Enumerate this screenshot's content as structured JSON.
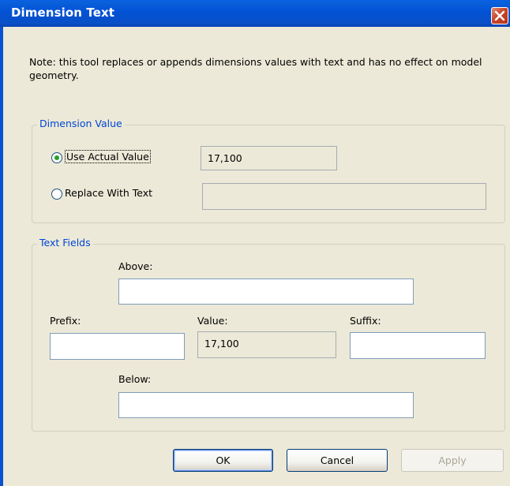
{
  "window": {
    "title": "Dimension Text"
  },
  "note": "Note: this tool replaces or appends dimensions values with text and has no effect on model geometry.",
  "dimension_value": {
    "legend": "Dimension Value",
    "use_actual_label": "Use Actual Value",
    "use_actual_value": "17,100",
    "replace_label": "Replace With Text",
    "replace_value": "",
    "selected": "use_actual"
  },
  "text_fields": {
    "legend": "Text Fields",
    "above_label": "Above:",
    "above_value": "",
    "prefix_label": "Prefix:",
    "prefix_value": "",
    "value_label": "Value:",
    "value_value": "17,100",
    "suffix_label": "Suffix:",
    "suffix_value": "",
    "below_label": "Below:",
    "below_value": ""
  },
  "buttons": {
    "ok": "OK",
    "cancel": "Cancel",
    "apply": "Apply"
  },
  "colors": {
    "titlebar": "#0a5ee6",
    "group_legend": "#0046d5",
    "dialog_bg": "#ece9d8"
  },
  "icons": {
    "close": "close-icon"
  }
}
